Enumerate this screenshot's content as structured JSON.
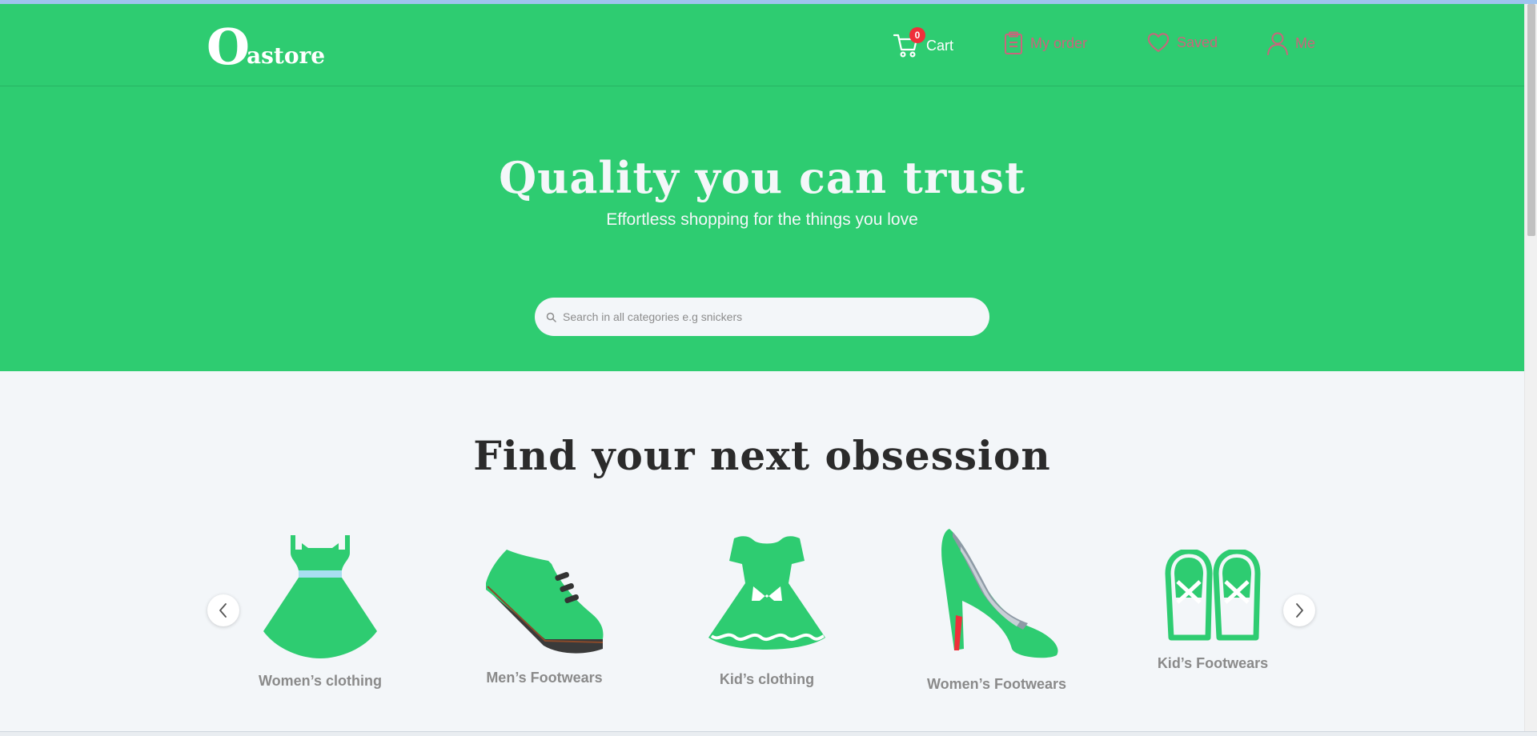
{
  "brand": {
    "logo_mark": "O",
    "logo_text": "astore"
  },
  "nav": {
    "cart": {
      "label": "Cart",
      "count": "0",
      "icon": "cart-icon"
    },
    "orders": {
      "label": "My order",
      "icon": "clipboard-icon"
    },
    "saved": {
      "label": "Saved",
      "icon": "heart-icon"
    },
    "me": {
      "label": "Me",
      "icon": "user-icon"
    }
  },
  "hero": {
    "title": "Quality you can trust",
    "subtitle": "Effortless shopping for the things you love",
    "search_placeholder": "Search in all categories e.g snickers"
  },
  "categories": {
    "title": "Find your next obsession",
    "items": [
      {
        "label": "Women’s clothing",
        "icon": "dress-icon"
      },
      {
        "label": "Men’s Footwears",
        "icon": "mens-shoe-icon"
      },
      {
        "label": "Kid’s clothing",
        "icon": "kids-dress-icon"
      },
      {
        "label": "Women’s Footwears",
        "icon": "high-heel-icon"
      },
      {
        "label": "Kid’s Footwears",
        "icon": "kids-shoes-icon"
      }
    ]
  },
  "colors": {
    "brand_green": "#2ecc71",
    "badge_red": "#ef2f3a",
    "muted_nav": "#c9657c",
    "page_bg": "#f3f6f9",
    "heading_dark": "#2b2b2b"
  }
}
